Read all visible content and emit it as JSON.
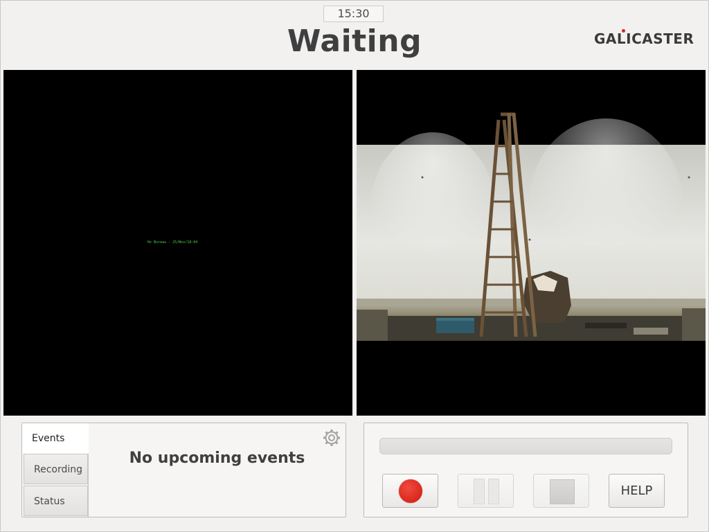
{
  "header": {
    "clock": "15:30",
    "status": "Waiting",
    "logo": "GALICASTER"
  },
  "previews": {
    "left_ticker": "Hz Bureau  -  25/Nov/18:04"
  },
  "events_panel": {
    "tabs": [
      {
        "label": "Events",
        "active": true
      },
      {
        "label": "Recording",
        "active": false
      },
      {
        "label": "Status",
        "active": false
      }
    ],
    "message": "No upcoming events",
    "settings_icon": "gear-icon"
  },
  "controls": {
    "progress": 0,
    "record_icon": "record-icon",
    "pause_icon": "pause-icon",
    "stop_icon": "stop-icon",
    "help_label": "HELP",
    "record_color": "#e02a1f"
  }
}
